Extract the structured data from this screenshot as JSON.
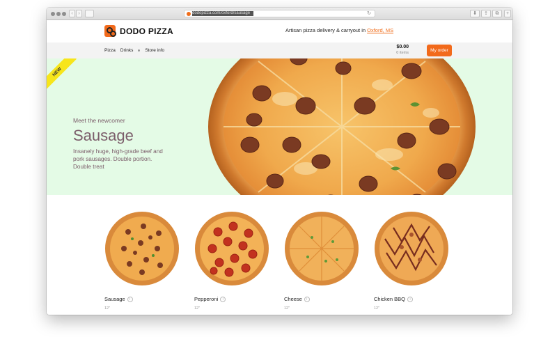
{
  "browser": {
    "url_text": "dodopizza.com/oxford/sausage",
    "back_label": "‹",
    "forward_label": "›",
    "reload_label": "↻",
    "download_label": "⬇",
    "share_label": "⇪",
    "tabs_label": "⧉",
    "add_tab_label": "+"
  },
  "header": {
    "brand_name": "DODO PIZZA",
    "tagline_prefix": "Artisan pizza delivery & carryout in",
    "tagline_city": "Oxford, MS"
  },
  "nav": {
    "items": [
      {
        "label": "Pizza"
      },
      {
        "label": "Drinks"
      },
      {
        "label": "Store info"
      }
    ]
  },
  "cart": {
    "amount": "$0.00",
    "count_text": "0 items",
    "order_label": "My order"
  },
  "hero": {
    "ribbon": "NEW",
    "kicker": "Meet the newcomer",
    "title": "Sausage",
    "description": "Insanely huge, high-grade beef and pork sausages. Double portion. Double treat",
    "bg_color": "#e4fbe6",
    "text_color": "#7b5d6a"
  },
  "products": [
    {
      "name": "Sausage",
      "size": "12\"",
      "topping": "sausage"
    },
    {
      "name": "Pepperoni",
      "size": "12\"",
      "topping": "pepperoni"
    },
    {
      "name": "Cheese",
      "size": "12\"",
      "topping": "cheese"
    },
    {
      "name": "Chicken BBQ",
      "size": "12\"",
      "topping": "bbq"
    }
  ],
  "colors": {
    "accent": "#f26a1b",
    "ribbon": "#f7e51b"
  }
}
